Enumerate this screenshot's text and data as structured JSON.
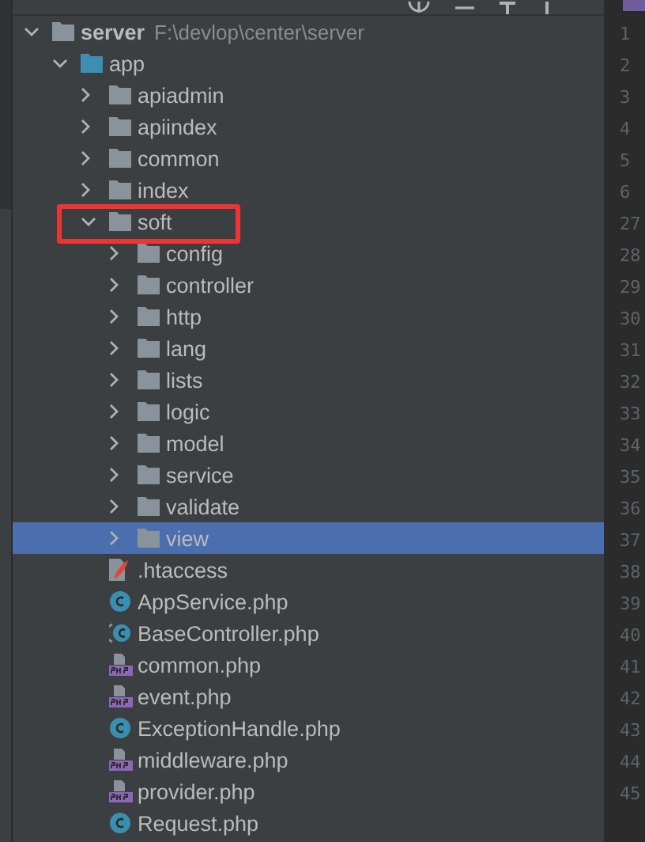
{
  "tree": [
    {
      "name": "server",
      "path": "F:\\devlop\\center\\server",
      "kind": "module",
      "expanded": true,
      "selected": false,
      "marked": false,
      "children": [
        {
          "name": "app",
          "kind": "source-folder",
          "expanded": true,
          "selected": false,
          "marked": false,
          "children": [
            {
              "name": "apiadmin",
              "kind": "folder",
              "expanded": false,
              "selected": false,
              "marked": false
            },
            {
              "name": "apiindex",
              "kind": "folder",
              "expanded": false,
              "selected": false,
              "marked": false
            },
            {
              "name": "common",
              "kind": "folder",
              "expanded": false,
              "selected": false,
              "marked": false
            },
            {
              "name": "index",
              "kind": "folder",
              "expanded": false,
              "selected": false,
              "marked": false
            },
            {
              "name": "soft",
              "kind": "folder",
              "expanded": true,
              "selected": false,
              "marked": true,
              "children": [
                {
                  "name": "config",
                  "kind": "folder",
                  "expanded": false,
                  "selected": false,
                  "marked": false
                },
                {
                  "name": "controller",
                  "kind": "folder",
                  "expanded": false,
                  "selected": false,
                  "marked": false
                },
                {
                  "name": "http",
                  "kind": "folder",
                  "expanded": false,
                  "selected": false,
                  "marked": false
                },
                {
                  "name": "lang",
                  "kind": "folder",
                  "expanded": false,
                  "selected": false,
                  "marked": false
                },
                {
                  "name": "lists",
                  "kind": "folder",
                  "expanded": false,
                  "selected": false,
                  "marked": false
                },
                {
                  "name": "logic",
                  "kind": "folder",
                  "expanded": false,
                  "selected": false,
                  "marked": false
                },
                {
                  "name": "model",
                  "kind": "folder",
                  "expanded": false,
                  "selected": false,
                  "marked": false
                },
                {
                  "name": "service",
                  "kind": "folder",
                  "expanded": false,
                  "selected": false,
                  "marked": false
                },
                {
                  "name": "validate",
                  "kind": "folder",
                  "expanded": false,
                  "selected": false,
                  "marked": false
                },
                {
                  "name": "view",
                  "kind": "folder",
                  "expanded": false,
                  "selected": true,
                  "marked": false
                }
              ]
            },
            {
              "name": ".htaccess",
              "kind": "config-file",
              "selected": false,
              "marked": false
            },
            {
              "name": "AppService.php",
              "kind": "class",
              "selected": false,
              "marked": false
            },
            {
              "name": "BaseController.php",
              "kind": "abstract-class",
              "selected": false,
              "marked": false
            },
            {
              "name": "common.php",
              "kind": "php",
              "selected": false,
              "marked": false
            },
            {
              "name": "event.php",
              "kind": "php",
              "selected": false,
              "marked": false
            },
            {
              "name": "ExceptionHandle.php",
              "kind": "class",
              "selected": false,
              "marked": false
            },
            {
              "name": "middleware.php",
              "kind": "php",
              "selected": false,
              "marked": false
            },
            {
              "name": "provider.php",
              "kind": "php",
              "selected": false,
              "marked": false
            },
            {
              "name": "Request.php",
              "kind": "class",
              "selected": false,
              "marked": false
            }
          ]
        }
      ]
    }
  ],
  "line_numbers": [
    "1",
    "2",
    "3",
    "4",
    "5",
    "6",
    "27",
    "28",
    "29",
    "30",
    "31",
    "32",
    "33",
    "34",
    "35",
    "36",
    "37",
    "38",
    "39",
    "40",
    "41",
    "42",
    "43",
    "44",
    "45"
  ]
}
